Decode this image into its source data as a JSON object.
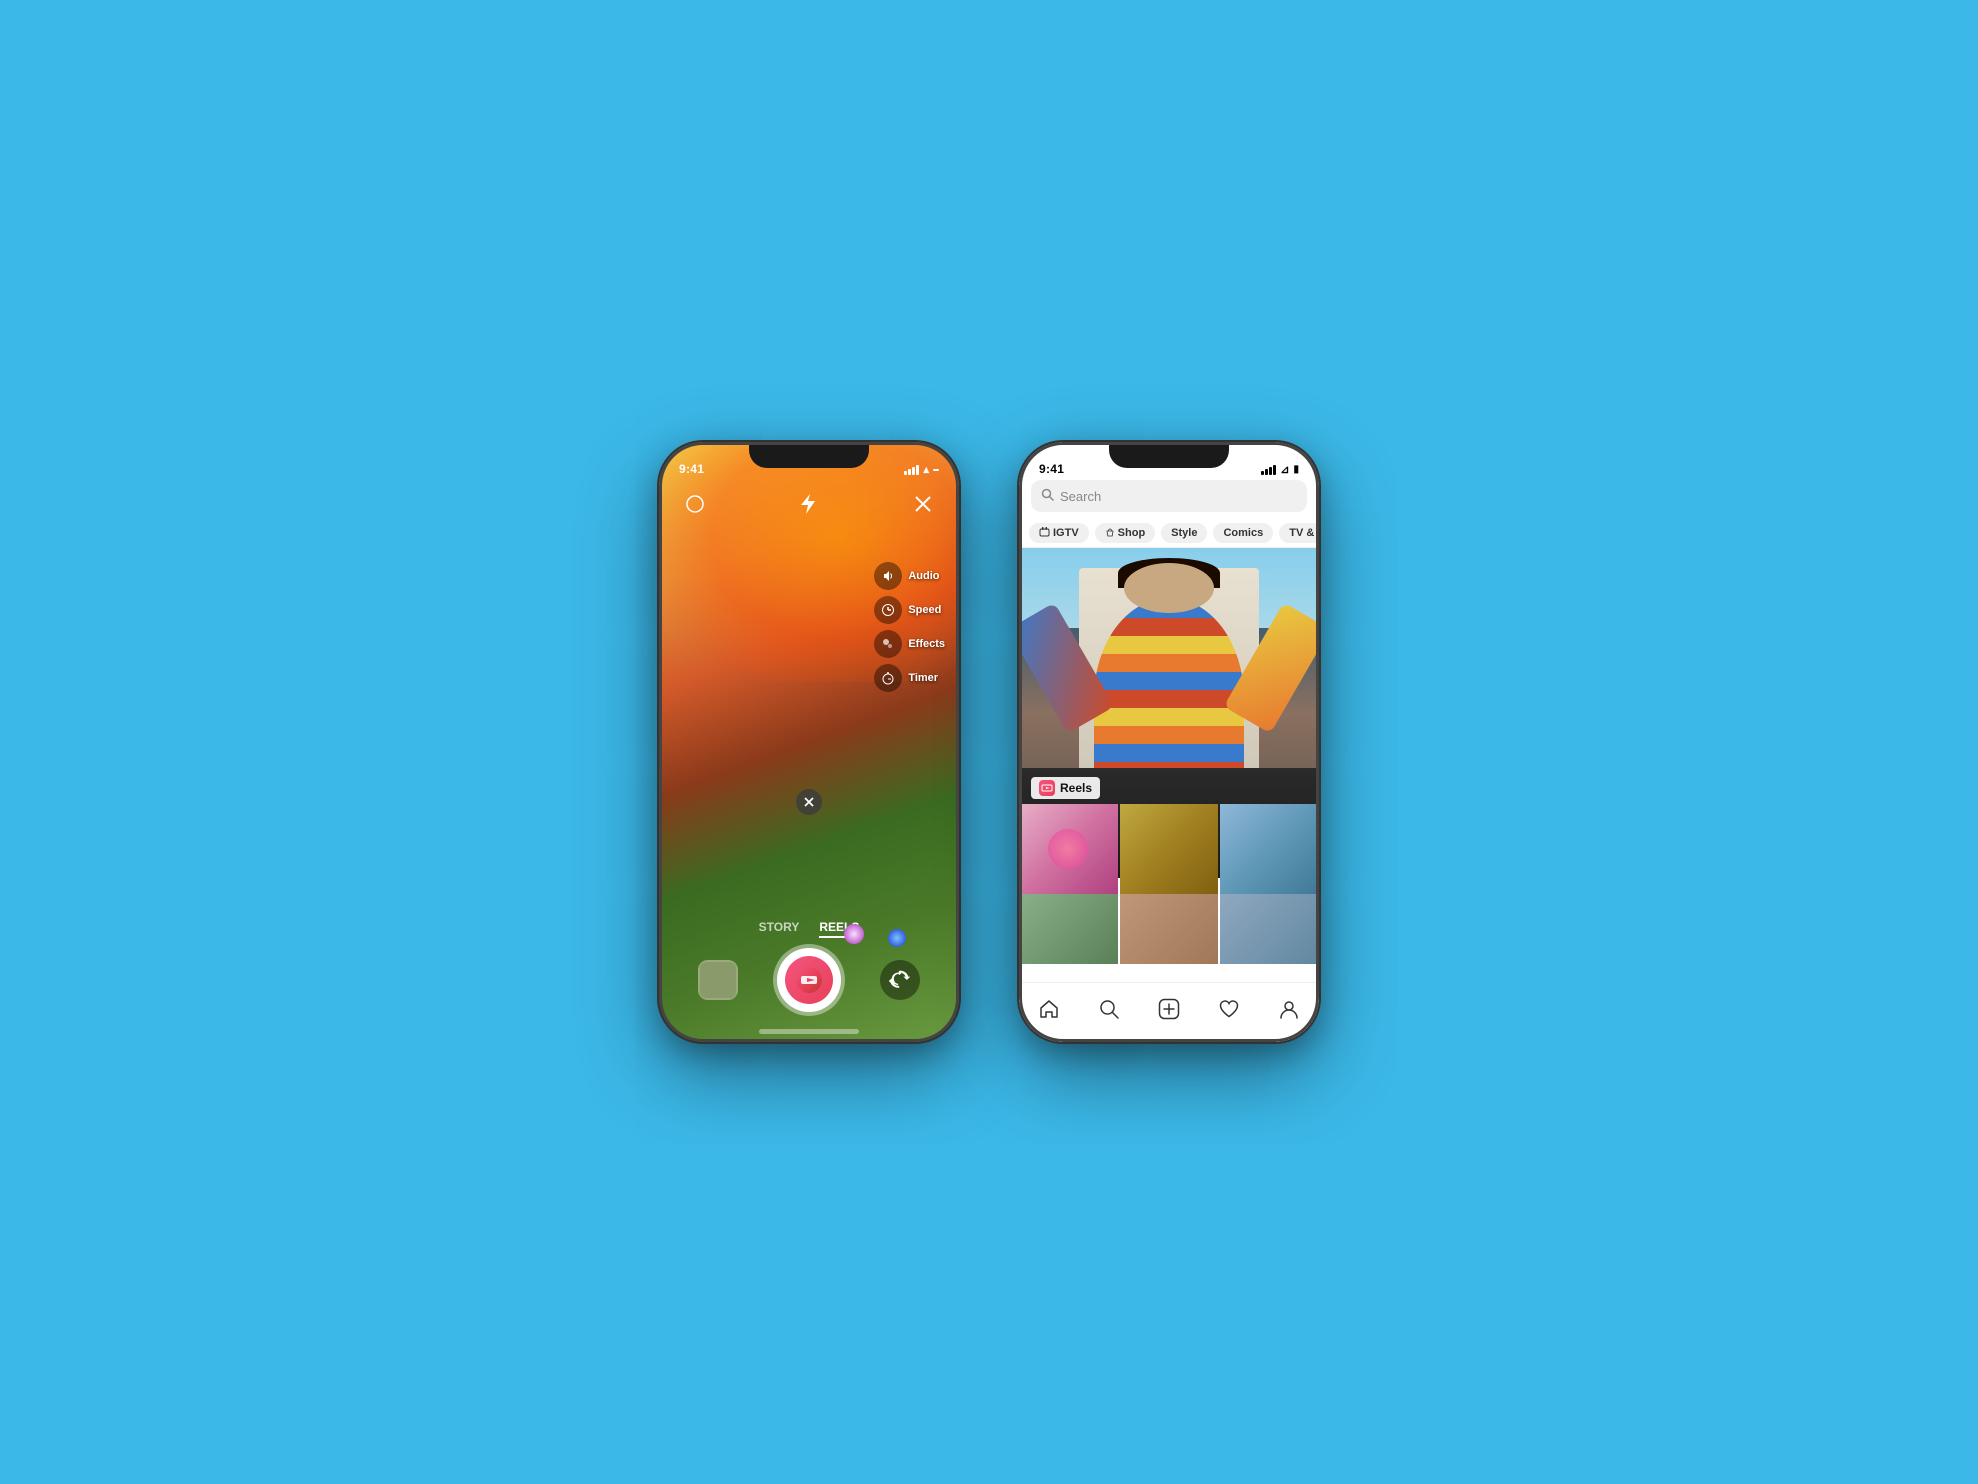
{
  "background": "#3bb8e8",
  "phone_camera": {
    "time": "9:41",
    "controls": {
      "audio_label": "Audio",
      "speed_label": "Speed",
      "effects_label": "Effects",
      "timer_label": "Timer"
    },
    "modes": {
      "story": "STORY",
      "reels": "REELS"
    }
  },
  "phone_explore": {
    "time": "9:41",
    "search": {
      "placeholder": "Search"
    },
    "tabs": [
      {
        "label": "IGTV",
        "active": false
      },
      {
        "label": "Shop",
        "active": false
      },
      {
        "label": "Style",
        "active": false
      },
      {
        "label": "Comics",
        "active": false
      },
      {
        "label": "TV & Movies",
        "active": false
      }
    ],
    "reels_label": "Reels",
    "nav": {
      "home": "⌂",
      "search": "🔍",
      "add": "+",
      "heart": "♡",
      "profile": "👤"
    }
  }
}
